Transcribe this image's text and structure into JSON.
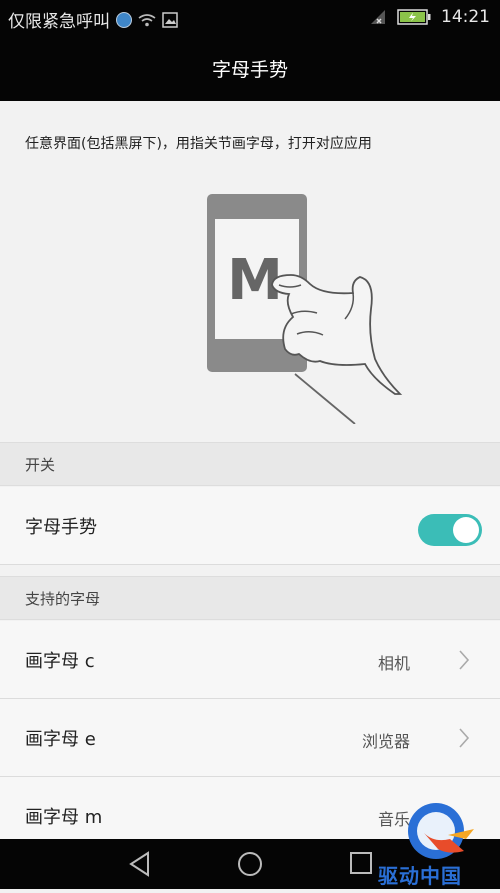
{
  "status_bar": {
    "carrier_text": "仅限紧急呼叫",
    "time": "14:21"
  },
  "title_bar": {
    "title": "字母手势"
  },
  "intro": {
    "text": "任意界面(包括黑屏下)，用指关节画字母，打开对应应用"
  },
  "illustration": {
    "letter": "M"
  },
  "sections": {
    "switch_header": "开关",
    "letters_header": "支持的字母"
  },
  "toggle_row": {
    "label": "字母手势",
    "enabled": true
  },
  "letter_rows": [
    {
      "label": "画字母 c",
      "value": "相机"
    },
    {
      "label": "画字母 e",
      "value": "浏览器"
    },
    {
      "label": "画字母 m",
      "value": "音乐"
    }
  ],
  "watermark": {
    "text": "驱动中国"
  },
  "colors": {
    "accent": "#3bbdb7",
    "bar": "#050505"
  }
}
